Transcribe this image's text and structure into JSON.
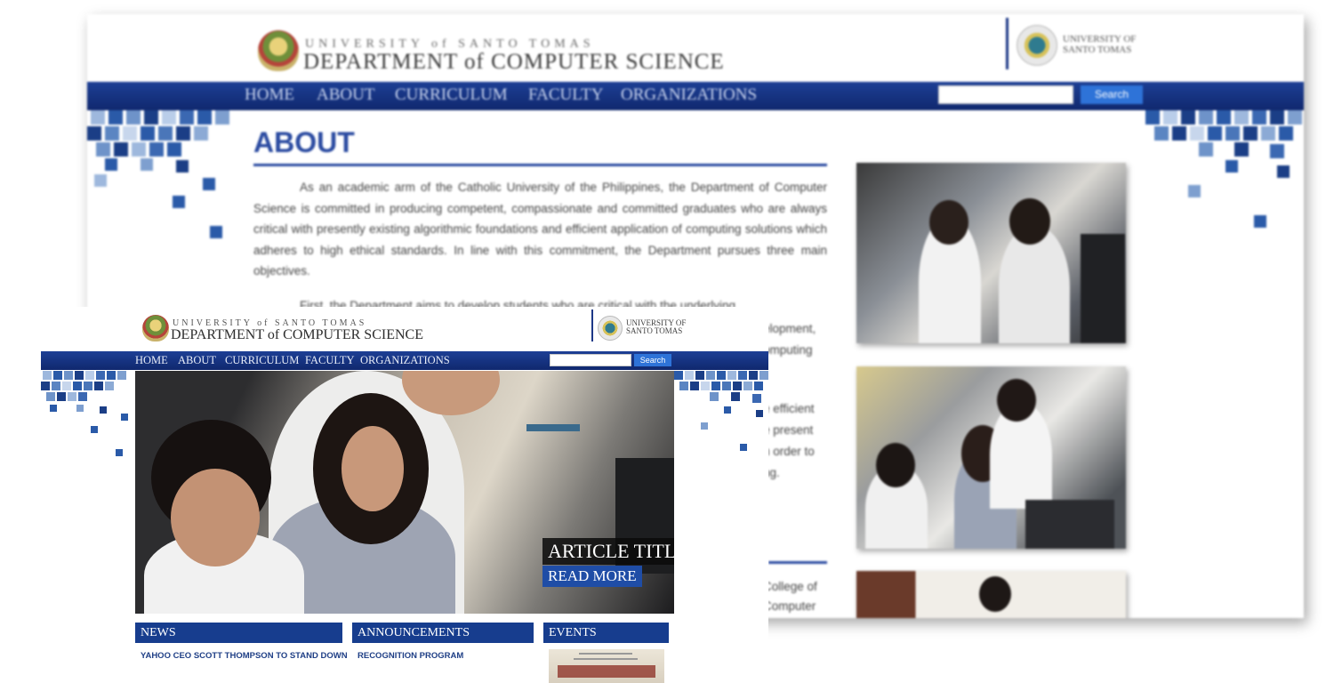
{
  "back_page": {
    "header": {
      "university_line": "UNIVERSITY of SANTO TOMAS",
      "department_line": "DEPARTMENT of COMPUTER SCIENCE",
      "partner_logo_text": "UNIVERSITY of SANTO TOMAS"
    },
    "nav": [
      "HOME",
      "ABOUT",
      "CURRICULUM",
      "FACULTY",
      "ORGANIZATIONS"
    ],
    "search": {
      "button": "Search",
      "placeholder": ""
    },
    "about": {
      "title": "ABOUT",
      "paragraph_1": "As an academic arm of the Catholic University of the Philippines, the Department of Computer Science is committed in producing competent, compassionate and committed graduates who are always critical with presently existing algorithmic foundations and efficient application of computing solutions which adheres to high ethical standards. In line with this commitment, the Department pursues three main objectives.",
      "paragraph_2": "First, the Department aims to develop students who are critical with the underlying",
      "fragments": [
        "elopment,",
        "omputing",
        "e efficient",
        "e present",
        "n order to",
        "ng.",
        "College of",
        "Computer"
      ]
    },
    "photos": [
      "students-lab-photo-1",
      "students-lab-photo-2",
      "student-photo-3"
    ]
  },
  "front_page": {
    "header": {
      "university_line": "UNIVERSITY of SANTO TOMAS",
      "department_line": "DEPARTMENT of COMPUTER SCIENCE",
      "partner_logo_text": "UNIVERSITY of SANTO TOMAS"
    },
    "nav": [
      "HOME",
      "ABOUT",
      "CURRICULUM",
      "FACULTY",
      "ORGANIZATIONS"
    ],
    "search": {
      "button": "Search",
      "placeholder": ""
    },
    "hero": {
      "article_title": "ARTICLE TITLE HERE",
      "read_more": "READ MORE"
    },
    "sections": {
      "news": {
        "title": "NEWS",
        "item": "YAHOO CEO SCOTT THOMPSON TO STAND DOWN"
      },
      "announcements": {
        "title": "ANNOUNCEMENTS",
        "item": "RECOGNITION PROGRAM"
      },
      "events": {
        "title": "EVENTS"
      }
    }
  },
  "colors": {
    "nav_blue": "#173d8e",
    "title_blue": "#2b4ba1",
    "search_blue": "#2e73d8",
    "link_blue": "#1f3f86"
  }
}
